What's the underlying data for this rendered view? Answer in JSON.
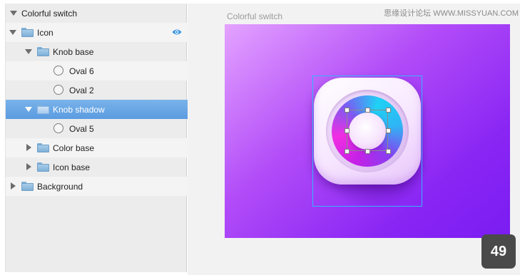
{
  "layers": {
    "items": [
      {
        "label": "Colorful switch",
        "kind": "header",
        "expanded": true
      },
      {
        "label": "Icon",
        "kind": "folder",
        "expanded": true
      },
      {
        "label": "Knob base",
        "kind": "folder",
        "expanded": true
      },
      {
        "label": "Oval 6",
        "kind": "oval"
      },
      {
        "label": "Oval 2",
        "kind": "oval"
      },
      {
        "label": "Knob shadow",
        "kind": "folder",
        "expanded": true,
        "selected": true
      },
      {
        "label": "Oval 5",
        "kind": "oval"
      },
      {
        "label": "Color base",
        "kind": "folder",
        "expanded": false
      },
      {
        "label": "Icon base",
        "kind": "folder",
        "expanded": false
      },
      {
        "label": "Background",
        "kind": "folder",
        "expanded": false
      }
    ],
    "visibility_icon": "eye-icon"
  },
  "canvas": {
    "artboard_title": "Colorful switch",
    "watermark": "思缘设计论坛 WWW.MISSYUAN.COM",
    "page_number": "49",
    "colors": {
      "artboard_start": "#e4a3ff",
      "artboard_end": "#7a1cf2",
      "selection": "#35b4ff",
      "ring_magenta": "#f12ee2",
      "ring_cyan": "#1fd1f5"
    }
  }
}
